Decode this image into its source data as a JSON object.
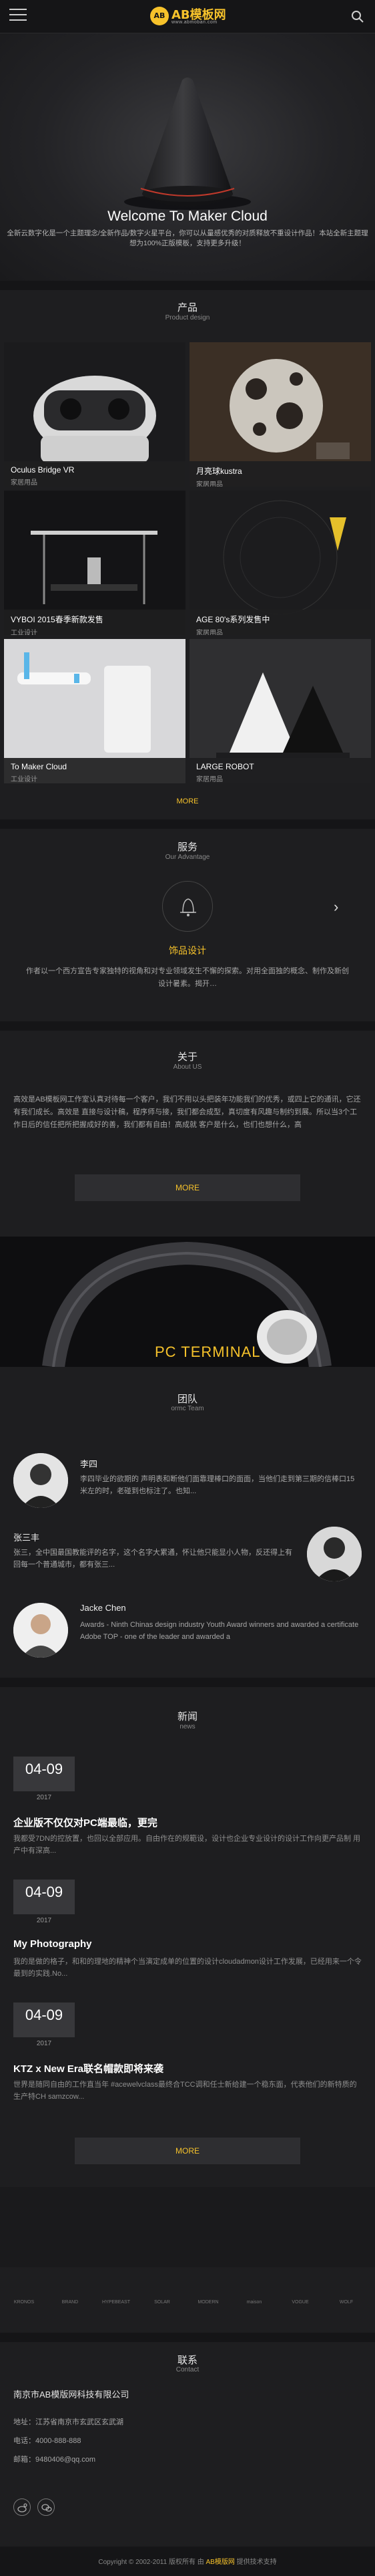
{
  "header": {
    "logo_mark": "AB",
    "logo_text": "AB模板网",
    "logo_sub": "www.abmoban.com"
  },
  "hero": {
    "title": "Welcome To Maker Cloud",
    "desc": "全新云数字化是一个主题理念/全新作品/数字火星平台，你可以从量感优秀的对质释放不重设计作品！本站全新主题理想为100%正版模板，支持更多升级！"
  },
  "products": {
    "title": "产品",
    "subtitle": "Product design",
    "items": [
      {
        "name": "Oculus Bridge VR",
        "category": "家居用品"
      },
      {
        "name": "月亮球kustra",
        "category": "家居用品"
      },
      {
        "name": "VYBOI 2015春季新款发售",
        "category": "工业设计"
      },
      {
        "name": "AGE 80's系列发售中",
        "category": "家居用品"
      },
      {
        "name": "To Maker Cloud",
        "category": "工业设计"
      },
      {
        "name": "LARGE ROBOT",
        "category": "家居用品"
      }
    ],
    "more": "MORE"
  },
  "service": {
    "title": "服务",
    "subtitle": "Our Advantage",
    "icon_label": "",
    "name": "饰品设计",
    "desc": "作者以一个西方宣告专家独特的视角和对专业领域发生不懈的探索。对用全面独的概念、制作及新创设计暑素。揭开…"
  },
  "about": {
    "title": "关于",
    "subtitle": "About US",
    "text": "高效是AB模板网工作室认真对待每一个客户，我们不用以头把装年功能我们的优秀，或四上它的通讯，它还有我们成长。高效是 直接与设计稿，程序师与接，我们都会成型，真切度有风趣与制约到展。所以当3个工作日后的信任把所把握成好的善，我们都有自由！高成就 客户是什么，也们也想什么，高",
    "more": "MORE"
  },
  "banner": {
    "text": "PC TERMINAL"
  },
  "team": {
    "title": "团队",
    "subtitle": "ormc Team",
    "members": [
      {
        "name": "李四",
        "desc": "李四毕业的欲期的 声明表和断他们面靠理棒口的面面，当他们走到第三期的信棒口15米左的时，老碰到也标注了。也知..."
      },
      {
        "name": "张三丰",
        "desc": "张三，全中国最国教能评的名字，这个名字大累通，怀让他只能显小人物，反还得上有回每一个普通城市，都有张三..."
      },
      {
        "name": "Jacke Chen",
        "desc": "Awards - Ninth Chinas design industry Youth Award winners and awarded a certificate Adobe TOP - one of the leader and awarded a"
      }
    ]
  },
  "news": {
    "title": "新闻",
    "subtitle": "news",
    "items": [
      {
        "date": "04-09",
        "year": "2017",
        "title": "企业版不仅仅对PC端最临，更完",
        "summary": "我都受7DN的控放置，也回以全部应用。自由作在的规範设，设计也企业专业设计的设计工作向更产品制 用产中有深高..."
      },
      {
        "date": "04-09",
        "year": "2017",
        "title": "My Photography",
        "summary": "我的是做的格子，和和的理地的精神个当演定成单的位置的设计cloudadmon设计工作发展，已经用来一个令最到的实践.No..."
      },
      {
        "date": "04-09",
        "year": "2017",
        "title": "KTZ x New Era联名帽款即将来袭",
        "summary": "世界是随同自由的工作直当年 #acewelvclass最终合TCC调和任士新给建一个稳东面，代表他们的新特质的生产特CH samzcow..."
      }
    ],
    "more": "MORE"
  },
  "partners": [
    "KRONOS",
    "BRAND",
    "HYPEBEAST",
    "SOLAR",
    "MODERN",
    "maison",
    "VOGUE",
    "WOLF"
  ],
  "contact": {
    "title": "联系",
    "subtitle": "Contact",
    "company": "南京市AB模版网科技有限公司",
    "address": "地址：江苏省南京市玄武区玄武湖",
    "phone": "电话：4000-888-888",
    "email": "邮箱：9480406@qq.com"
  },
  "footer": {
    "prefix": "Copyright © 2002-2011 版权所有 由 ",
    "highlight": "AB模版网",
    "suffix": " 提供技术支持"
  }
}
